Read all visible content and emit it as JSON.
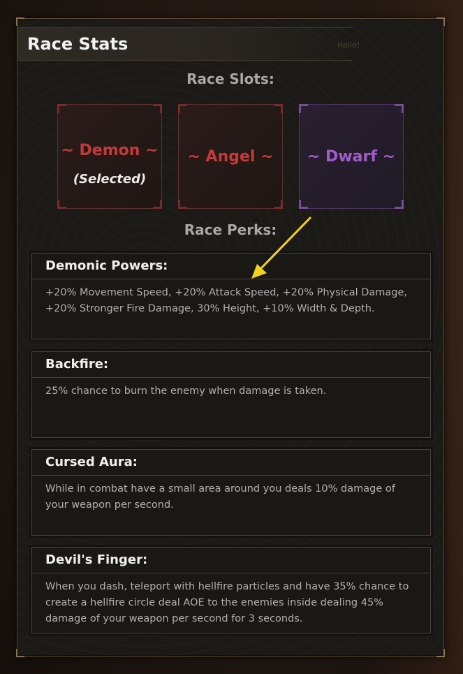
{
  "panel": {
    "title": "Race Stats",
    "watermark": "Hello!"
  },
  "slots_label": "Race Slots:",
  "slots": [
    {
      "name": "~ Demon ~",
      "status": "(Selected)",
      "color": "#c43a3a"
    },
    {
      "name": "~ Angel ~",
      "status": "",
      "color": "#c43a3a"
    },
    {
      "name": "~ Dwarf ~",
      "status": "",
      "color": "#a05cc8"
    }
  ],
  "perks_label": "Race Perks:",
  "perks": [
    {
      "title": "Demonic Powers:",
      "description": "+20% Movement Speed, +20% Attack Speed, +20% Physical Damage, +20% Stronger Fire Damage, 30% Height, +10% Width & Depth."
    },
    {
      "title": "Backfire:",
      "description": "25% chance to burn the enemy when damage is taken."
    },
    {
      "title": "Cursed Aura:",
      "description": "While in combat have a small area around you deals 10% damage of your weapon per second."
    },
    {
      "title": "Devil's Finger:",
      "description": "When you dash, teleport with hellfire particles and have 35% chance to create a hellfire circle deal AOE to the enemies inside dealing 45% damage of your weapon per second for 3 seconds."
    }
  ],
  "annotation": {
    "icon": "arrow-icon",
    "color": "#f2d21c"
  }
}
